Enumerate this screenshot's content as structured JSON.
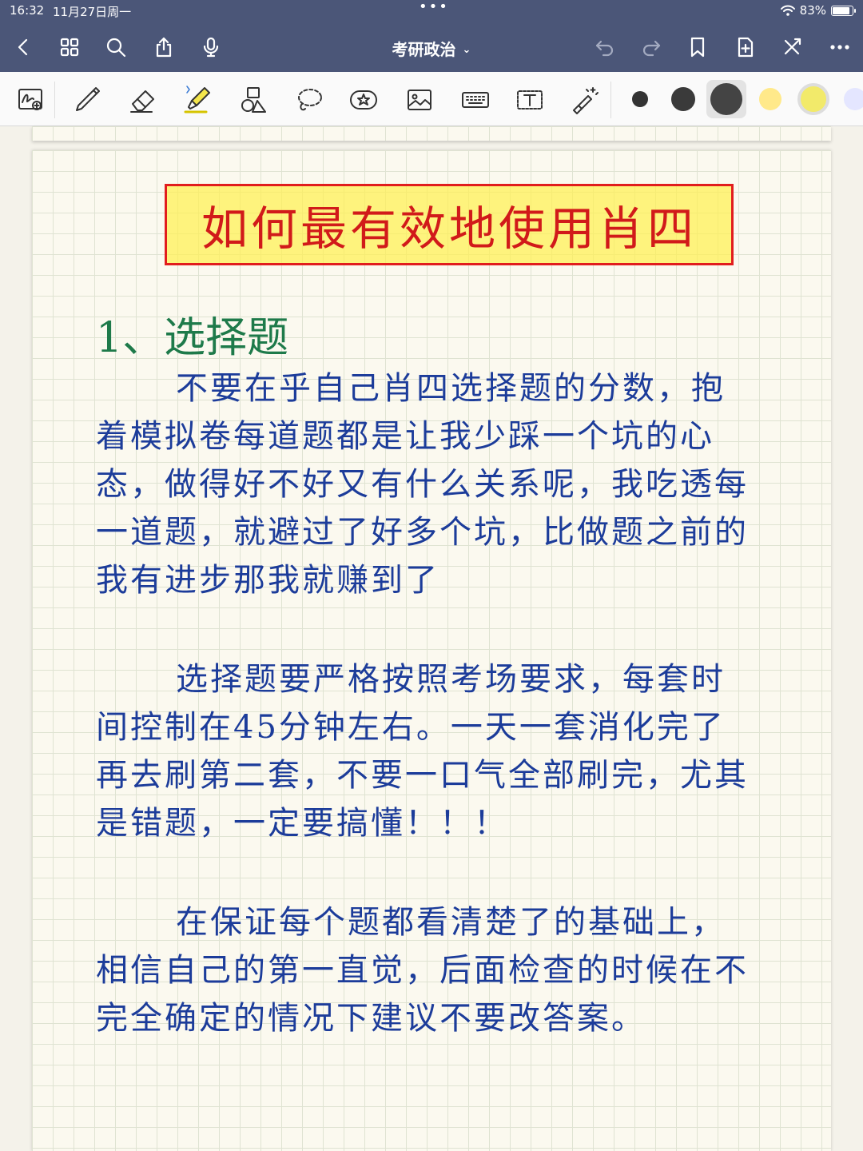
{
  "status_bar": {
    "time": "16:32",
    "date": "11月27日周一",
    "battery": "83%"
  },
  "nav": {
    "title": "考研政治",
    "title_chevron": "⌄",
    "icons": [
      "back-icon",
      "grid-icon",
      "search-icon",
      "share-icon",
      "microphone-icon",
      "undo-icon",
      "redo-icon",
      "bookmark-icon",
      "add-page-icon",
      "close-icon",
      "more-icon"
    ]
  },
  "toolbar": {
    "tools": [
      "handwriting-search-icon",
      "pen-icon",
      "eraser-icon",
      "highlighter-icon",
      "shapes-icon",
      "lasso-icon",
      "sticker-icon",
      "image-icon",
      "keyboard-icon",
      "text-icon",
      "laser-pointer-icon"
    ],
    "colors": {
      "dot_small": "#333333",
      "dot_medium": "#3a3a3a",
      "dot_large": "#444444",
      "yellow_1": "#ffe98a",
      "yellow_2": "#f2ea6a",
      "lavender": "#e4e6ff"
    }
  },
  "note": {
    "title": "如何最有效地使用肖四",
    "section": "1、选择题",
    "paragraphs": [
      "不要在乎自己肖四选择题的分数，抱着模拟卷每道题都是让我少踩一个坑的心态，做得好不好又有什么关系呢，我吃透每一道题，就避过了好多个坑，比做题之前的我有进步那我就赚到了",
      "选择题要严格按照考场要求，每套时间控制在45分钟左右。一天一套消化完了再去刷第二套，不要一口气全部刷完，尤其是错题，一定要搞懂！！！",
      "在保证每个题都看清楚了的基础上，相信自己的第一直觉，后面检查的时候在不完全确定的情况下建议不要改答案。"
    ],
    "colors": {
      "title_text": "#d11a1a",
      "title_border": "#e11d1d",
      "highlight": "#fff050",
      "section_text": "#1e7a4a",
      "body_text": "#1c3c9a"
    }
  }
}
